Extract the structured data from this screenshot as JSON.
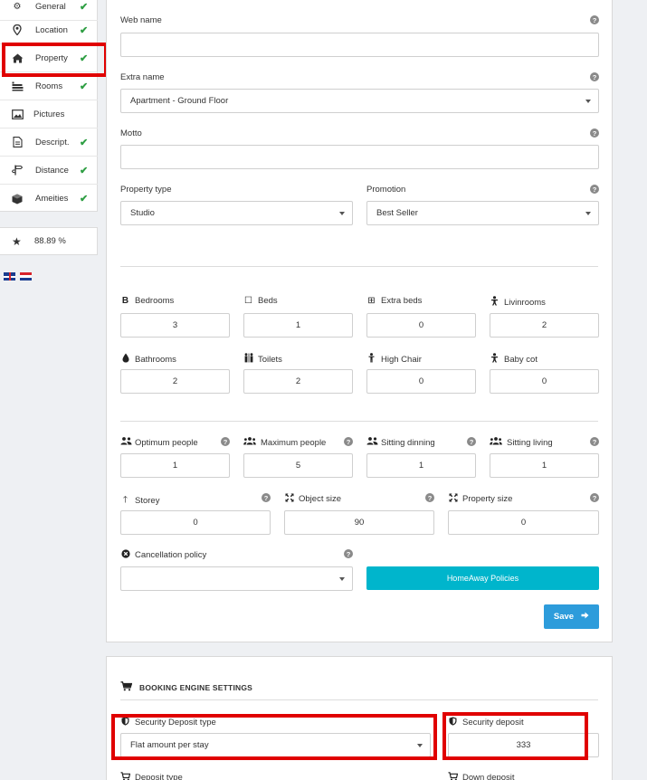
{
  "sidebar": {
    "items": [
      {
        "label": "General",
        "check": "✔"
      },
      {
        "label": "Location",
        "check": "✔"
      },
      {
        "label": "Property",
        "check": "✔"
      },
      {
        "label": "Rooms",
        "check": "✔"
      },
      {
        "label": "Pictures",
        "check": ""
      },
      {
        "label": "Descript.",
        "check": "✔"
      },
      {
        "label": "Distance",
        "check": "✔"
      },
      {
        "label": "Ameities",
        "check": "✔"
      }
    ],
    "score": "88.89 %"
  },
  "form": {
    "web_name": {
      "label": "Web name",
      "value": ""
    },
    "extra_name": {
      "label": "Extra name",
      "value": "Apartment - Ground Floor"
    },
    "motto": {
      "label": "Motto",
      "value": ""
    },
    "property_type": {
      "label": "Property type",
      "value": "Studio"
    },
    "promotion": {
      "label": "Promotion",
      "value": "Best Seller"
    },
    "bedrooms": {
      "label": "Bedrooms",
      "value": "3"
    },
    "beds": {
      "label": "Beds",
      "value": "1"
    },
    "extra_beds": {
      "label": "Extra beds",
      "value": "0"
    },
    "livinrooms": {
      "label": "Livinrooms",
      "value": "2"
    },
    "bathrooms": {
      "label": "Bathrooms",
      "value": "2"
    },
    "toilets": {
      "label": "Toilets",
      "value": "2"
    },
    "high_chair": {
      "label": "High Chair",
      "value": "0"
    },
    "baby_cot": {
      "label": "Baby cot",
      "value": "0"
    },
    "optimum_people": {
      "label": "Optimum people",
      "value": "1"
    },
    "maximum_people": {
      "label": "Maximum people",
      "value": "5"
    },
    "sitting_dinning": {
      "label": "Sitting dinning",
      "value": "1"
    },
    "sitting_living": {
      "label": "Sitting living",
      "value": "1"
    },
    "storey": {
      "label": "Storey",
      "value": "0"
    },
    "object_size": {
      "label": "Object size",
      "value": "90"
    },
    "property_size": {
      "label": "Property size",
      "value": "0"
    },
    "cancellation_policy": {
      "label": "Cancellation policy",
      "value": ""
    },
    "policies_button": "HomeAway Policies",
    "save_button": "Save",
    "help_glyph": "?"
  },
  "booking": {
    "title": "BOOKING ENGINE SETTINGS",
    "deposit_type": {
      "label": "Security Deposit type",
      "value": "Flat amount per stay"
    },
    "security_deposit": {
      "label": "Security deposit",
      "value": "333"
    },
    "deposit_type2": {
      "label": "Deposit type"
    },
    "down_deposit": {
      "label": "Down deposit"
    }
  },
  "colors": {
    "accent_cyan": "#00b5cc",
    "save_blue": "#2d9cdb",
    "check_green": "#2e9e43",
    "highlight_red": "#e00000"
  }
}
